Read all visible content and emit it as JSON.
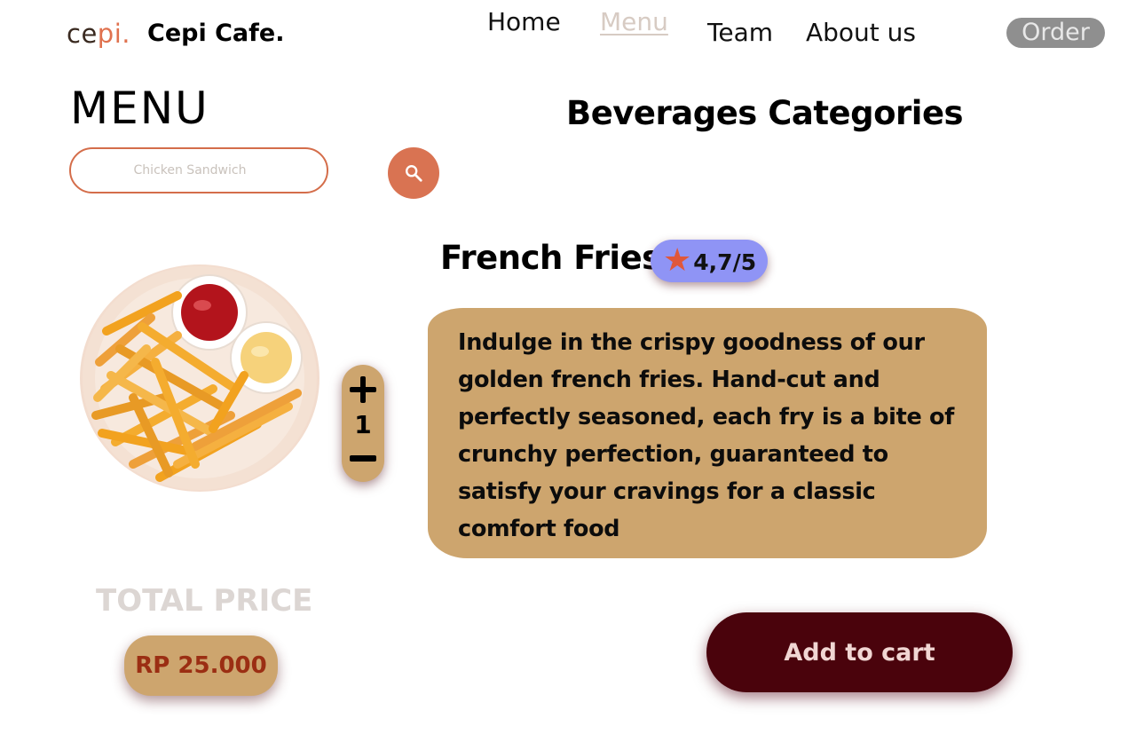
{
  "header": {
    "logo": {
      "part1": "ce",
      "part2": "pi."
    },
    "brand": "Cepi Cafe.",
    "nav": {
      "home": "Home",
      "menu": "Menu",
      "team": "Team",
      "about": "About us"
    },
    "order_label": "Order"
  },
  "menu_section": {
    "title": "MENU",
    "search": {
      "placeholder": "Chicken Sandwich",
      "icon": "search-icon"
    }
  },
  "categories_title": "Beverages Categories",
  "product": {
    "name": "French Fries",
    "rating": "4,7/5",
    "image": "french-fries-plate",
    "quantity": "1",
    "description": "Indulge in the crispy goodness of our golden french fries. Hand-cut and perfectly seasoned, each fry is a bite of crunchy perfection, guaranteed to satisfy your cravings for a classic comfort food"
  },
  "total": {
    "label": "TOTAL PRICE",
    "price": "RP 25.000"
  },
  "cart_button": "Add to cart",
  "colors": {
    "accent": "#d97352",
    "card": "#cda56e",
    "rating_badge": "#8f94f5",
    "cart_button": "#4a030c",
    "price_text": "#9b2e13"
  }
}
